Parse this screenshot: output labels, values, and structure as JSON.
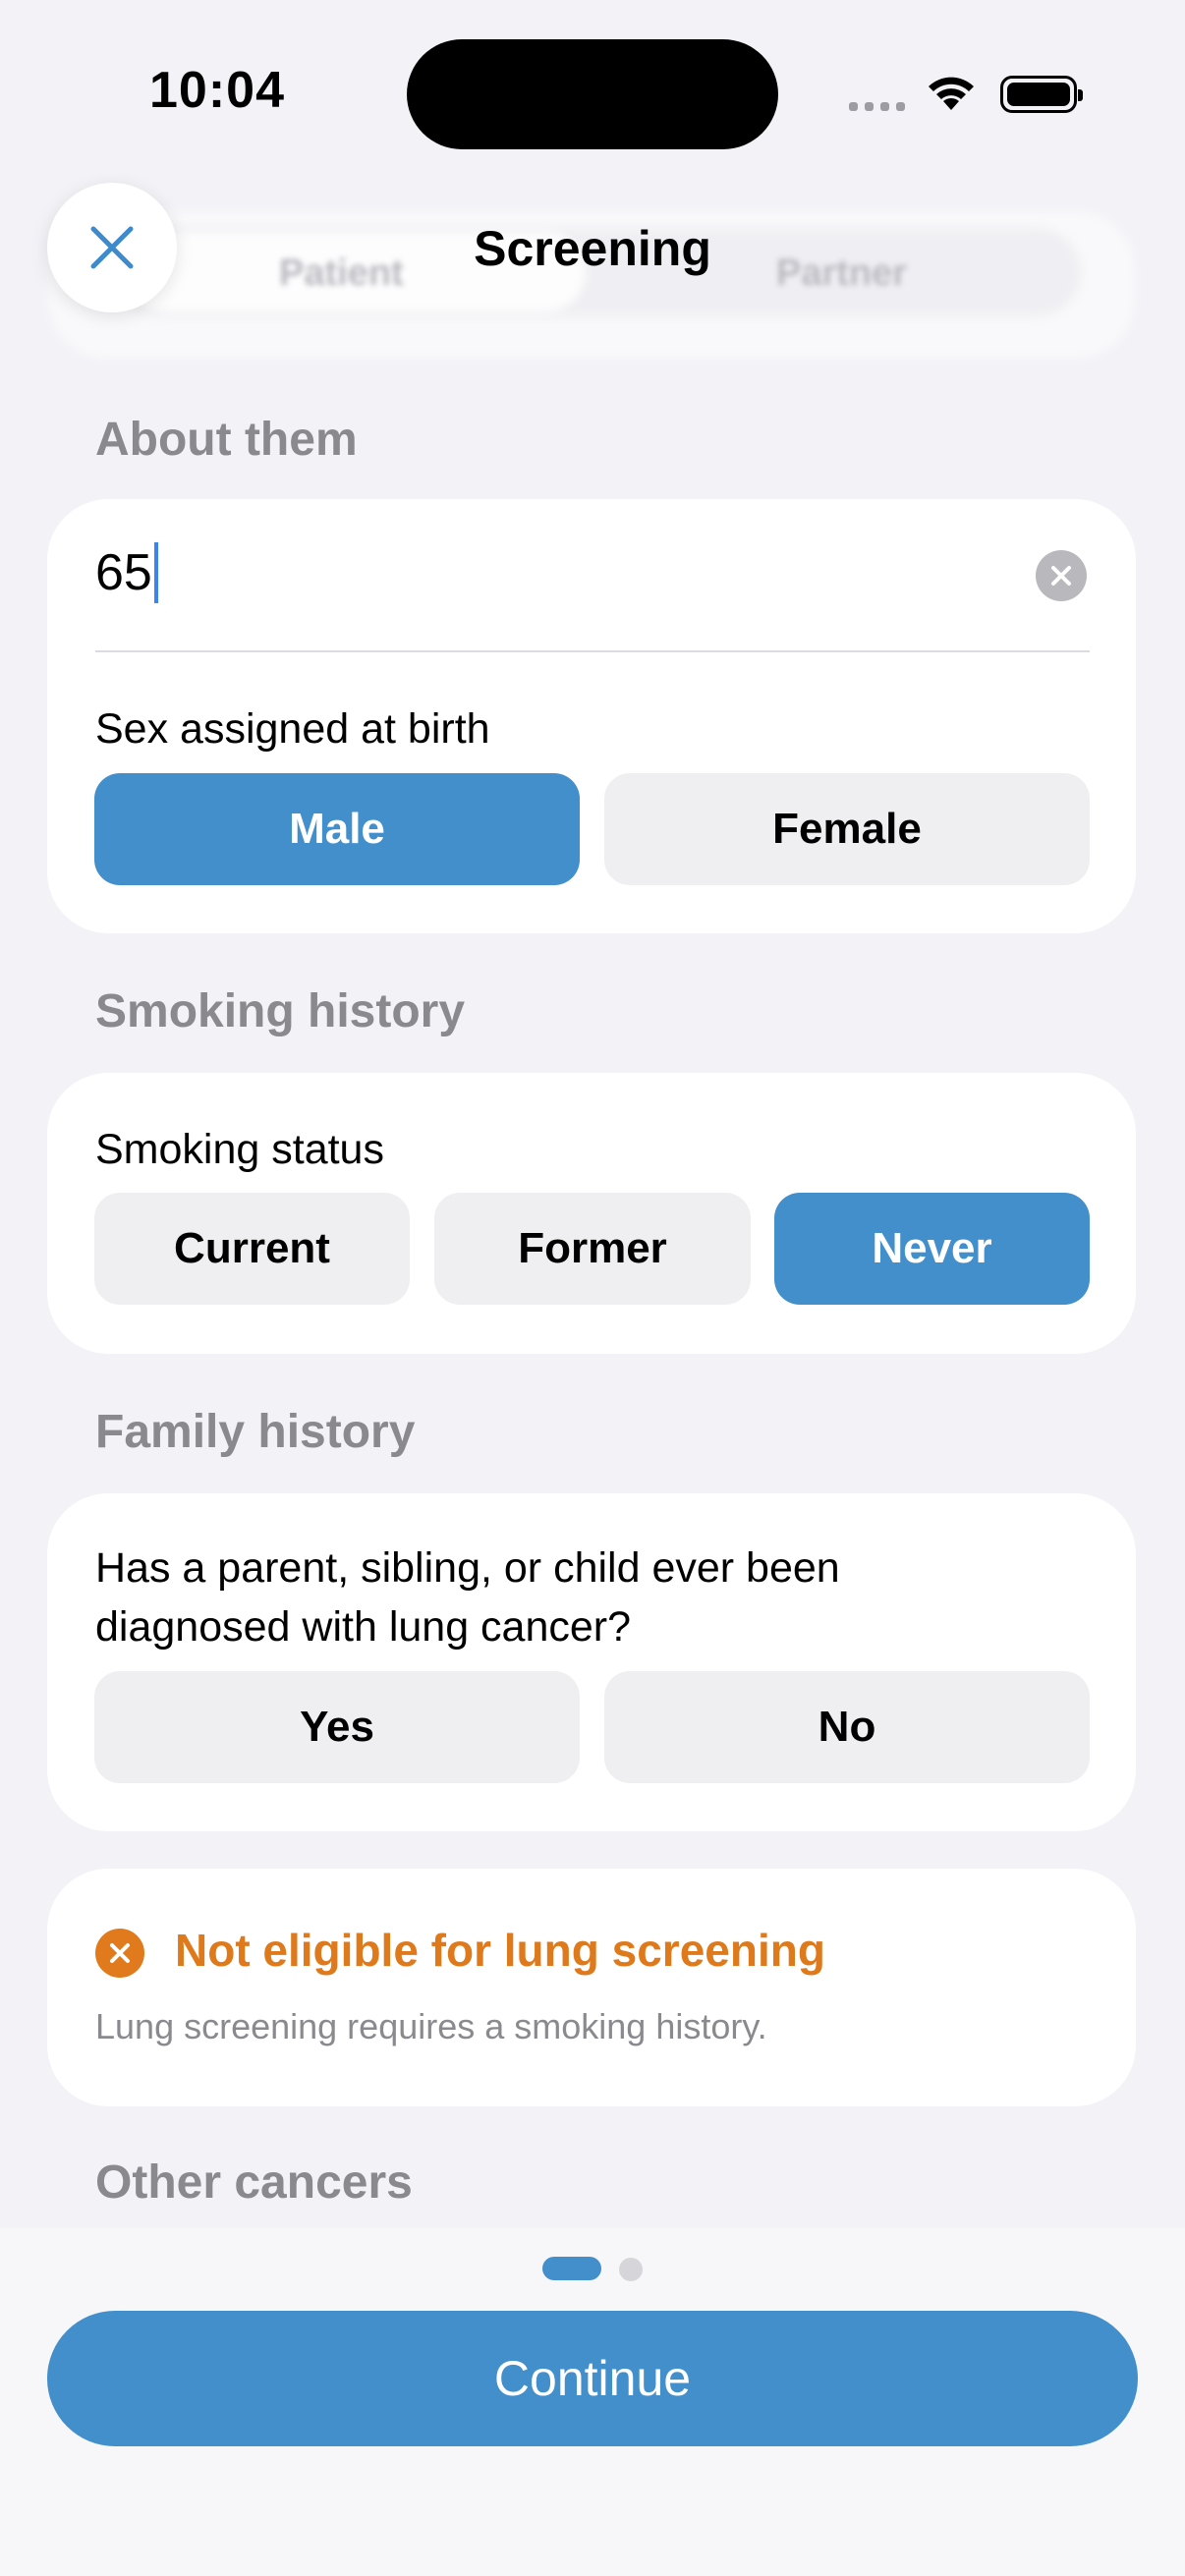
{
  "status_bar": {
    "time": "10:04"
  },
  "header": {
    "title": "Screening",
    "segments": [
      "Patient",
      "Partner"
    ]
  },
  "about": {
    "section_label": "About them",
    "age_value": "65",
    "sex_label": "Sex assigned at birth",
    "sex_options": [
      "Male",
      "Female"
    ],
    "sex_selected": "Male"
  },
  "smoking": {
    "section_label": "Smoking history",
    "status_label": "Smoking status",
    "options": [
      "Current",
      "Former",
      "Never"
    ],
    "selected": "Never"
  },
  "family": {
    "section_label": "Family history",
    "question": "Has a parent, sibling, or child ever been diagnosed with lung cancer?",
    "options": [
      "Yes",
      "No"
    ]
  },
  "eligibility": {
    "title": "Not eligible for lung screening",
    "message": "Lung screening requires a smoking history."
  },
  "other": {
    "section_label": "Other cancers"
  },
  "pager": {
    "current": 1,
    "total": 2
  },
  "footer": {
    "continue_label": "Continue"
  },
  "colors": {
    "accent": "#428fcc",
    "warning": "#de7a1c",
    "background": "#f2f2f7"
  }
}
